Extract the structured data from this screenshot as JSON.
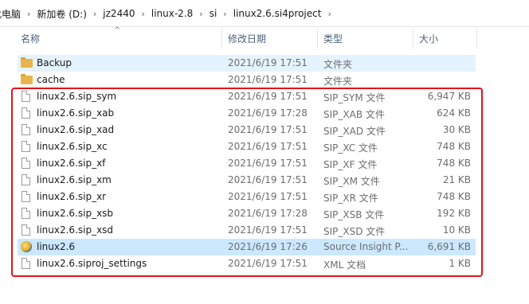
{
  "breadcrumb": [
    "此电脑",
    "新加卷 (D:)",
    "jz2440",
    "linux-2.8",
    "si",
    "linux2.6.si4project"
  ],
  "columns": {
    "name": "名称",
    "date": "修改日期",
    "type": "类型",
    "size": "大小"
  },
  "files": [
    {
      "name": "Backup",
      "date": "2021/6/19 17:51",
      "type": "文件夹",
      "size": "",
      "icon": "folder-icon"
    },
    {
      "name": "cache",
      "date": "2021/6/19 17:51",
      "type": "文件夹",
      "size": "",
      "icon": "folder-icon"
    },
    {
      "name": "linux2.6.sip_sym",
      "date": "2021/6/19 17:51",
      "type": "SIP_SYM 文件",
      "size": "6,947 KB",
      "icon": "file-icon"
    },
    {
      "name": "linux2.6.sip_xab",
      "date": "2021/6/19 17:28",
      "type": "SIP_XAB 文件",
      "size": "624 KB",
      "icon": "file-icon"
    },
    {
      "name": "linux2.6.sip_xad",
      "date": "2021/6/19 17:51",
      "type": "SIP_XAD 文件",
      "size": "30 KB",
      "icon": "file-icon"
    },
    {
      "name": "linux2.6.sip_xc",
      "date": "2021/6/19 17:51",
      "type": "SIP_XC 文件",
      "size": "748 KB",
      "icon": "file-icon"
    },
    {
      "name": "linux2.6.sip_xf",
      "date": "2021/6/19 17:51",
      "type": "SIP_XF 文件",
      "size": "748 KB",
      "icon": "file-icon"
    },
    {
      "name": "linux2.6.sip_xm",
      "date": "2021/6/19 17:51",
      "type": "SIP_XM 文件",
      "size": "21 KB",
      "icon": "file-icon"
    },
    {
      "name": "linux2.6.sip_xr",
      "date": "2021/6/19 17:51",
      "type": "SIP_XR 文件",
      "size": "748 KB",
      "icon": "file-icon"
    },
    {
      "name": "linux2.6.sip_xsb",
      "date": "2021/6/19 17:28",
      "type": "SIP_XSB 文件",
      "size": "192 KB",
      "icon": "file-icon"
    },
    {
      "name": "linux2.6.sip_xsd",
      "date": "2021/6/19 17:51",
      "type": "SIP_XSD 文件",
      "size": "10 KB",
      "icon": "file-icon"
    },
    {
      "name": "linux2.6",
      "date": "2021/6/19 17:26",
      "type": "Source Insight P...",
      "size": "6,691 KB",
      "icon": "source-insight-project-icon"
    },
    {
      "name": "linux2.6.siproj_settings",
      "date": "2021/6/19 17:51",
      "type": "XML 文档",
      "size": "1 KB",
      "icon": "file-icon"
    }
  ],
  "colors": {
    "selected_row": "#cce8ff",
    "hover_row": "#e5f3ff",
    "annotation_box": "#e2141b"
  }
}
